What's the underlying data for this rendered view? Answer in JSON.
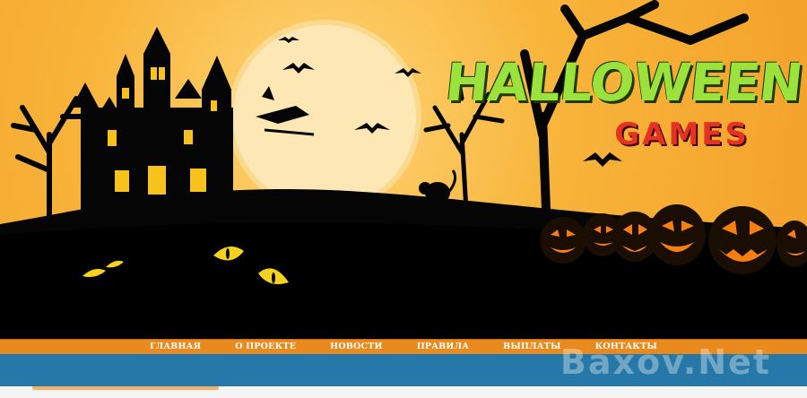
{
  "logo": {
    "title": "HALLOWEEN",
    "subtitle": "GAMES"
  },
  "nav": {
    "items": [
      {
        "label": "ГЛАВНАЯ"
      },
      {
        "label": "О ПРОЕКТЕ"
      },
      {
        "label": "НОВОСТИ"
      },
      {
        "label": "ПРАВИЛА"
      },
      {
        "label": "ВЫПЛАТЫ"
      },
      {
        "label": "КОНТАКТЫ"
      }
    ]
  },
  "watermark": "Baxov.Net",
  "colors": {
    "sky": "#f5a623",
    "moon": "#fde7b5",
    "nav": "#e98a1e",
    "band": "#2578a7",
    "logo_green": "#9be23c",
    "logo_red": "#e53222"
  }
}
